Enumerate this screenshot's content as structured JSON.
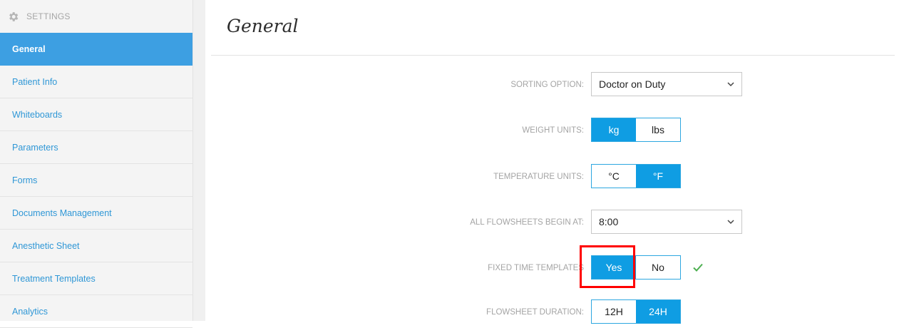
{
  "sidebar": {
    "header": "SETTINGS",
    "items": [
      {
        "label": "General",
        "active": true
      },
      {
        "label": "Patient Info"
      },
      {
        "label": "Whiteboards"
      },
      {
        "label": "Parameters"
      },
      {
        "label": "Forms"
      },
      {
        "label": "Documents Management"
      },
      {
        "label": "Anesthetic Sheet"
      },
      {
        "label": "Treatment Templates"
      },
      {
        "label": "Analytics"
      }
    ]
  },
  "main": {
    "title": "General",
    "settings": {
      "sorting": {
        "label": "SORTING OPTION:",
        "value": "Doctor on Duty"
      },
      "weight": {
        "label": "WEIGHT UNITS:",
        "options": [
          "kg",
          "lbs"
        ],
        "selected": "kg"
      },
      "temperature": {
        "label": "TEMPERATURE UNITS:",
        "options": [
          "°C",
          "°F"
        ],
        "selected": "°F"
      },
      "flowsheet_begin": {
        "label": "ALL FLOWSHEETS BEGIN AT:",
        "value": "8:00"
      },
      "fixed_time": {
        "label": "FIXED TIME TEMPLATES",
        "options": [
          "Yes",
          "No"
        ],
        "selected": "Yes",
        "saved_indicator": "check-icon"
      },
      "flowsheet_duration": {
        "label": "FLOWSHEET DURATION:",
        "options": [
          "12H",
          "24H"
        ],
        "selected": "24H"
      }
    }
  },
  "colors": {
    "accent": "#0f9de3",
    "sidebar_active": "#3d9fe2",
    "link": "#2f97d6",
    "success": "#4caf50",
    "highlight": "#ff0000"
  }
}
